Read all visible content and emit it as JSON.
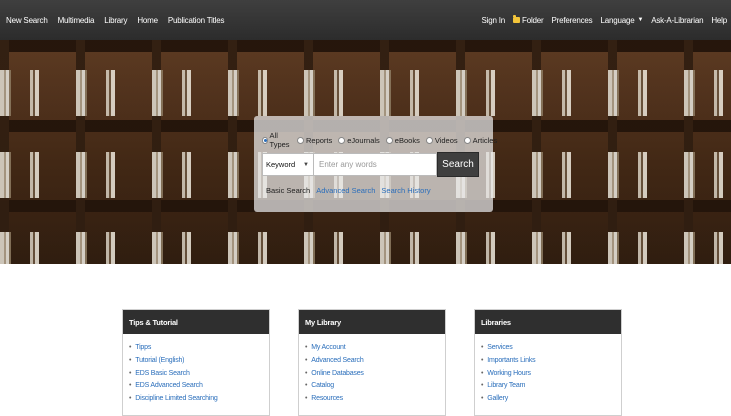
{
  "nav": {
    "left": [
      "New Search",
      "Multimedia",
      "Library",
      "Home",
      "Publication Titles"
    ],
    "sign_in": "Sign In",
    "folder": "Folder",
    "preferences": "Preferences",
    "language": "Language",
    "ask_librarian": "Ask-A-Librarian",
    "help": "Help"
  },
  "search": {
    "types": [
      {
        "label": "All Types",
        "selected": true
      },
      {
        "label": "Reports",
        "selected": false
      },
      {
        "label": "eJournals",
        "selected": false
      },
      {
        "label": "eBooks",
        "selected": false
      },
      {
        "label": "Videos",
        "selected": false
      },
      {
        "label": "Articles",
        "selected": false
      }
    ],
    "field": "Keyword",
    "placeholder": "Enter any words",
    "button": "Search",
    "basic_search": "Basic Search",
    "advanced_search": "Advanced Search",
    "search_history": "Search History"
  },
  "cards": [
    {
      "title": "Tips & Tutorial",
      "items": [
        "Tipps",
        "Tutorial (English)",
        "EDS Basic Search",
        "EDS Advanced Search",
        "Discipline Limited Searching"
      ]
    },
    {
      "title": "My Library",
      "items": [
        "My Account",
        "Advanced Search",
        "Online Databases",
        "Catalog",
        "Resources"
      ]
    },
    {
      "title": "Libraries",
      "items": [
        "Services",
        "Importants Links",
        "Working Hours",
        "Library Team",
        "Gallery"
      ]
    }
  ],
  "colors": {
    "accent": "#2a6ebb",
    "topbar": "#333333",
    "folder": "#f3c53a"
  }
}
